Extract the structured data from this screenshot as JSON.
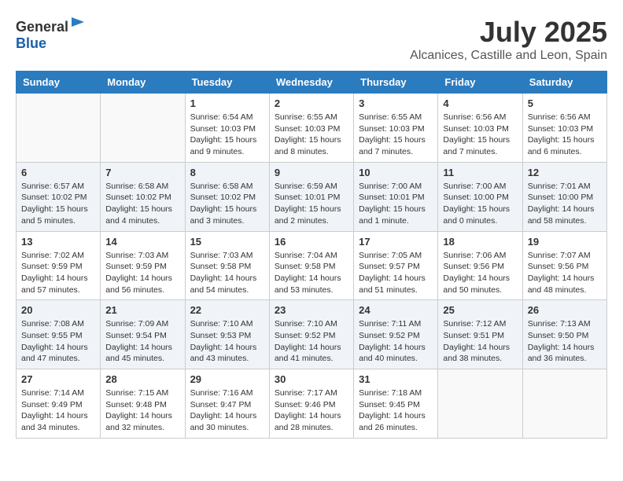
{
  "header": {
    "logo_general": "General",
    "logo_blue": "Blue",
    "month_year": "July 2025",
    "location": "Alcanices, Castille and Leon, Spain"
  },
  "weekdays": [
    "Sunday",
    "Monday",
    "Tuesday",
    "Wednesday",
    "Thursday",
    "Friday",
    "Saturday"
  ],
  "weeks": [
    [
      {
        "day": "",
        "sunrise": "",
        "sunset": "",
        "daylight": ""
      },
      {
        "day": "",
        "sunrise": "",
        "sunset": "",
        "daylight": ""
      },
      {
        "day": "1",
        "sunrise": "Sunrise: 6:54 AM",
        "sunset": "Sunset: 10:03 PM",
        "daylight": "Daylight: 15 hours and 9 minutes."
      },
      {
        "day": "2",
        "sunrise": "Sunrise: 6:55 AM",
        "sunset": "Sunset: 10:03 PM",
        "daylight": "Daylight: 15 hours and 8 minutes."
      },
      {
        "day": "3",
        "sunrise": "Sunrise: 6:55 AM",
        "sunset": "Sunset: 10:03 PM",
        "daylight": "Daylight: 15 hours and 7 minutes."
      },
      {
        "day": "4",
        "sunrise": "Sunrise: 6:56 AM",
        "sunset": "Sunset: 10:03 PM",
        "daylight": "Daylight: 15 hours and 7 minutes."
      },
      {
        "day": "5",
        "sunrise": "Sunrise: 6:56 AM",
        "sunset": "Sunset: 10:03 PM",
        "daylight": "Daylight: 15 hours and 6 minutes."
      }
    ],
    [
      {
        "day": "6",
        "sunrise": "Sunrise: 6:57 AM",
        "sunset": "Sunset: 10:02 PM",
        "daylight": "Daylight: 15 hours and 5 minutes."
      },
      {
        "day": "7",
        "sunrise": "Sunrise: 6:58 AM",
        "sunset": "Sunset: 10:02 PM",
        "daylight": "Daylight: 15 hours and 4 minutes."
      },
      {
        "day": "8",
        "sunrise": "Sunrise: 6:58 AM",
        "sunset": "Sunset: 10:02 PM",
        "daylight": "Daylight: 15 hours and 3 minutes."
      },
      {
        "day": "9",
        "sunrise": "Sunrise: 6:59 AM",
        "sunset": "Sunset: 10:01 PM",
        "daylight": "Daylight: 15 hours and 2 minutes."
      },
      {
        "day": "10",
        "sunrise": "Sunrise: 7:00 AM",
        "sunset": "Sunset: 10:01 PM",
        "daylight": "Daylight: 15 hours and 1 minute."
      },
      {
        "day": "11",
        "sunrise": "Sunrise: 7:00 AM",
        "sunset": "Sunset: 10:00 PM",
        "daylight": "Daylight: 15 hours and 0 minutes."
      },
      {
        "day": "12",
        "sunrise": "Sunrise: 7:01 AM",
        "sunset": "Sunset: 10:00 PM",
        "daylight": "Daylight: 14 hours and 58 minutes."
      }
    ],
    [
      {
        "day": "13",
        "sunrise": "Sunrise: 7:02 AM",
        "sunset": "Sunset: 9:59 PM",
        "daylight": "Daylight: 14 hours and 57 minutes."
      },
      {
        "day": "14",
        "sunrise": "Sunrise: 7:03 AM",
        "sunset": "Sunset: 9:59 PM",
        "daylight": "Daylight: 14 hours and 56 minutes."
      },
      {
        "day": "15",
        "sunrise": "Sunrise: 7:03 AM",
        "sunset": "Sunset: 9:58 PM",
        "daylight": "Daylight: 14 hours and 54 minutes."
      },
      {
        "day": "16",
        "sunrise": "Sunrise: 7:04 AM",
        "sunset": "Sunset: 9:58 PM",
        "daylight": "Daylight: 14 hours and 53 minutes."
      },
      {
        "day": "17",
        "sunrise": "Sunrise: 7:05 AM",
        "sunset": "Sunset: 9:57 PM",
        "daylight": "Daylight: 14 hours and 51 minutes."
      },
      {
        "day": "18",
        "sunrise": "Sunrise: 7:06 AM",
        "sunset": "Sunset: 9:56 PM",
        "daylight": "Daylight: 14 hours and 50 minutes."
      },
      {
        "day": "19",
        "sunrise": "Sunrise: 7:07 AM",
        "sunset": "Sunset: 9:56 PM",
        "daylight": "Daylight: 14 hours and 48 minutes."
      }
    ],
    [
      {
        "day": "20",
        "sunrise": "Sunrise: 7:08 AM",
        "sunset": "Sunset: 9:55 PM",
        "daylight": "Daylight: 14 hours and 47 minutes."
      },
      {
        "day": "21",
        "sunrise": "Sunrise: 7:09 AM",
        "sunset": "Sunset: 9:54 PM",
        "daylight": "Daylight: 14 hours and 45 minutes."
      },
      {
        "day": "22",
        "sunrise": "Sunrise: 7:10 AM",
        "sunset": "Sunset: 9:53 PM",
        "daylight": "Daylight: 14 hours and 43 minutes."
      },
      {
        "day": "23",
        "sunrise": "Sunrise: 7:10 AM",
        "sunset": "Sunset: 9:52 PM",
        "daylight": "Daylight: 14 hours and 41 minutes."
      },
      {
        "day": "24",
        "sunrise": "Sunrise: 7:11 AM",
        "sunset": "Sunset: 9:52 PM",
        "daylight": "Daylight: 14 hours and 40 minutes."
      },
      {
        "day": "25",
        "sunrise": "Sunrise: 7:12 AM",
        "sunset": "Sunset: 9:51 PM",
        "daylight": "Daylight: 14 hours and 38 minutes."
      },
      {
        "day": "26",
        "sunrise": "Sunrise: 7:13 AM",
        "sunset": "Sunset: 9:50 PM",
        "daylight": "Daylight: 14 hours and 36 minutes."
      }
    ],
    [
      {
        "day": "27",
        "sunrise": "Sunrise: 7:14 AM",
        "sunset": "Sunset: 9:49 PM",
        "daylight": "Daylight: 14 hours and 34 minutes."
      },
      {
        "day": "28",
        "sunrise": "Sunrise: 7:15 AM",
        "sunset": "Sunset: 9:48 PM",
        "daylight": "Daylight: 14 hours and 32 minutes."
      },
      {
        "day": "29",
        "sunrise": "Sunrise: 7:16 AM",
        "sunset": "Sunset: 9:47 PM",
        "daylight": "Daylight: 14 hours and 30 minutes."
      },
      {
        "day": "30",
        "sunrise": "Sunrise: 7:17 AM",
        "sunset": "Sunset: 9:46 PM",
        "daylight": "Daylight: 14 hours and 28 minutes."
      },
      {
        "day": "31",
        "sunrise": "Sunrise: 7:18 AM",
        "sunset": "Sunset: 9:45 PM",
        "daylight": "Daylight: 14 hours and 26 minutes."
      },
      {
        "day": "",
        "sunrise": "",
        "sunset": "",
        "daylight": ""
      },
      {
        "day": "",
        "sunrise": "",
        "sunset": "",
        "daylight": ""
      }
    ]
  ]
}
